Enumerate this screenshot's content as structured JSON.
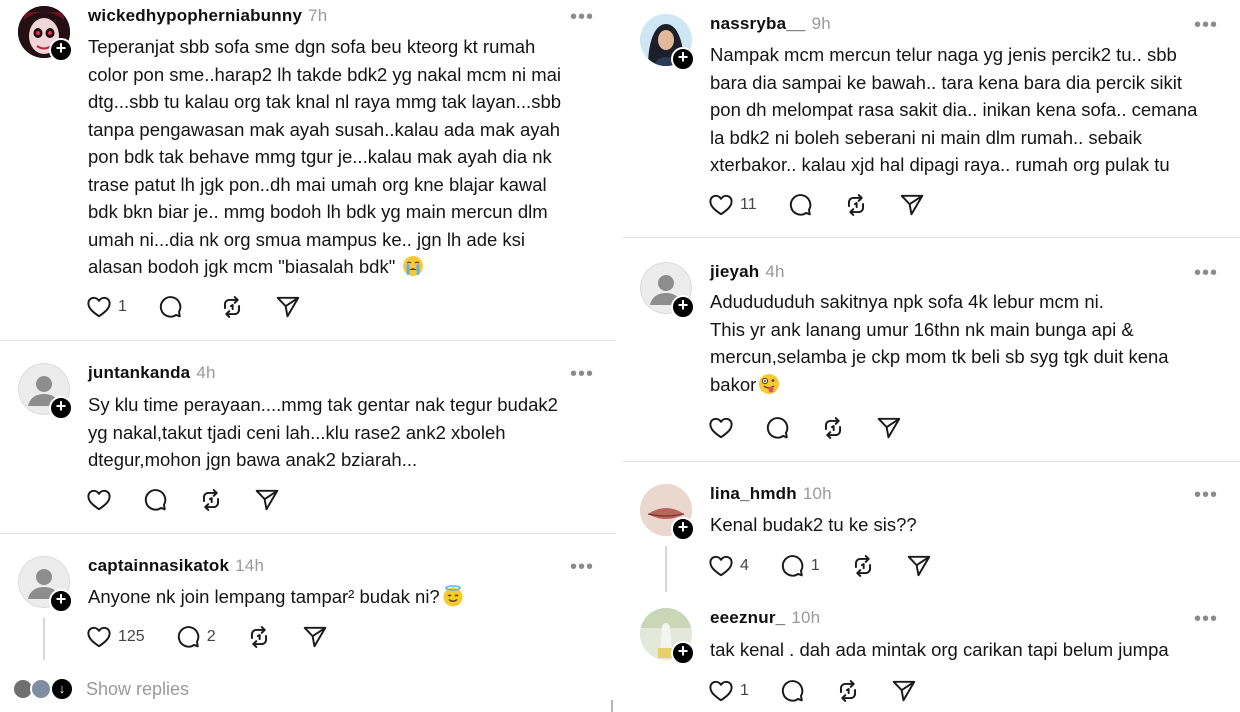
{
  "left": {
    "posts": [
      {
        "username": "wickedhypopherniabunny",
        "time": "7h",
        "text": "Teperanjat sbb sofa sme dgn sofa beu kteorg kt rumah\ncolor pon sme..harap2 lh takde bdk2 yg nakal mcm ni mai\ndtg...sbb tu kalau org tak knal nl raya mmg tak layan...sbb\ntanpa pengawasan mak ayah susah..kalau ada mak ayah\npon bdk tak behave mmg tgur je...kalau mak ayah dia nk\ntrase patut lh jgk pon..dh mai umah org kne blajar kawal\nbdk bkn biar je.. mmg bodoh lh bdk yg main mercun dlm\numah ni...dia nk org smua mampus ke.. jgn lh ade ksi\nalasan bodoh jgk mcm \"biasalah bdk\" ",
        "emoji": "loudly-crying-face",
        "likes": "1",
        "replies": "",
        "more": "•••"
      },
      {
        "username": "juntankanda",
        "time": "4h",
        "text": "Sy klu time perayaan....mmg tak gentar nak tegur budak2\nyg nakal,takut tjadi ceni lah...klu rase2 ank2 xboleh\ndtegur,mohon jgn bawa anak2 bziarah...",
        "likes": "",
        "replies": "",
        "more": "•••"
      },
      {
        "username": "captainnasikatok",
        "time": "14h",
        "text": "Anyone nk join lempang tampar² budak ni?",
        "emoji": "smiling-face-with-halo",
        "likes": "125",
        "replies": "2",
        "more": "•••"
      }
    ],
    "show_replies": "Show replies"
  },
  "right": {
    "posts": [
      {
        "username": "nassryba__",
        "time": "9h",
        "text": "Nampak mcm mercun telur naga yg jenis percik2 tu.. sbb\nbara dia sampai ke bawah.. tara kena bara dia percik sikit\npon dh melompat rasa sakit dia.. inikan kena sofa.. cemana\nla bdk2 ni boleh seberani ni main dlm rumah.. sebaik\nxterbakor.. kalau xjd hal dipagi raya.. rumah org pulak tu",
        "likes": "11",
        "replies": "",
        "more": "•••"
      },
      {
        "username": "jieyah",
        "time": "4h",
        "text": "Adudududuh sakitnya npk sofa 4k lebur mcm ni.\nThis yr ank lanang umur 16thn nk main bunga api &\nmercun,selamba je ckp mom tk beli sb syg tgk duit kena\nbakor",
        "emoji": "zany-face",
        "likes": "",
        "replies": "",
        "more": "•••"
      },
      {
        "username": "lina_hmdh",
        "time": "10h",
        "text": "Kenal budak2 tu ke sis??",
        "likes": "4",
        "replies": "1",
        "more": "•••"
      },
      {
        "username": "eeeznur_",
        "time": "10h",
        "text": "tak kenal . dah ada mintak org carikan tapi belum jumpa",
        "likes": "1",
        "replies": "",
        "more": "•••"
      }
    ]
  },
  "icons": {
    "like": "heart-icon",
    "reply": "comment-bubble-icon",
    "repost": "repost-icon",
    "share": "send-icon",
    "follow": "plus-icon",
    "more": "more-dots-icon"
  },
  "colors": {
    "text": "#101010",
    "muted": "#9a9a9a",
    "separator": "#e4e4e4"
  }
}
